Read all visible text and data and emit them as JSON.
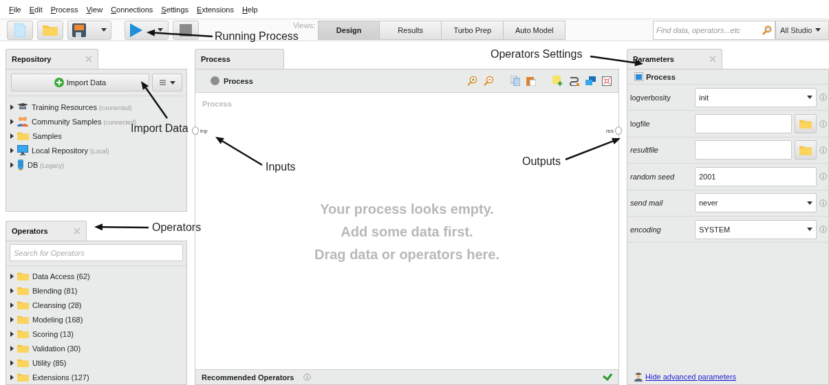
{
  "menu": [
    "File",
    "Edit",
    "Process",
    "View",
    "Connections",
    "Settings",
    "Extensions",
    "Help"
  ],
  "toolbar": {
    "views_label": "Views:",
    "views": [
      {
        "label": "Design",
        "selected": true
      },
      {
        "label": "Results",
        "selected": false
      },
      {
        "label": "Turbo Prep",
        "selected": false
      },
      {
        "label": "Auto Model",
        "selected": false
      }
    ],
    "search": {
      "placeholder": "Find data, operators...etc"
    },
    "scope": "All Studio"
  },
  "repository": {
    "title": "Repository",
    "import_button": "Import Data",
    "items": [
      {
        "kind": "training",
        "name": "Training Resources",
        "note": "(connected)",
        "expanded": false
      },
      {
        "kind": "community",
        "name": "Community Samples",
        "note": "(connected)",
        "expanded": false
      },
      {
        "kind": "folder",
        "name": "Samples",
        "expanded": false
      },
      {
        "kind": "local",
        "name": "Local Repository",
        "note": "(Local)",
        "expanded": false
      },
      {
        "kind": "database",
        "name": "DB",
        "note": "(Legacy)",
        "expanded": false
      }
    ]
  },
  "operators": {
    "title": "Operators",
    "search": {
      "placeholder": "Search for Operators"
    },
    "items": [
      {
        "name": "Data Access (62)",
        "expanded": false
      },
      {
        "name": "Blending (81)",
        "expanded": false
      },
      {
        "name": "Cleansing (28)",
        "expanded": false
      },
      {
        "name": "Modeling (168)",
        "expanded": false
      },
      {
        "name": "Scoring (13)",
        "expanded": false
      },
      {
        "name": "Validation (30)",
        "expanded": false
      },
      {
        "name": "Utility (85)",
        "expanded": false
      },
      {
        "name": "Extensions (127)",
        "expanded": false
      }
    ]
  },
  "process": {
    "title": "Process",
    "breadcrumb": "Process",
    "canvas_label": "Process",
    "input_port": "inp",
    "output_port": "res",
    "empty_message": [
      "Your process looks empty.",
      "Add some data first.",
      "Drag data or operators here."
    ],
    "recommended": "Recommended Operators"
  },
  "parameters": {
    "title": "Parameters",
    "operator": "Process",
    "rows": [
      {
        "kind": "select",
        "label": "logverbosity",
        "expert": false,
        "value": "init"
      },
      {
        "kind": "file",
        "label": "logfile",
        "expert": false
      },
      {
        "kind": "file",
        "label": "resultfile",
        "expert": true
      },
      {
        "kind": "text",
        "label": "random seed",
        "expert": true,
        "value": "2001"
      },
      {
        "kind": "select",
        "label": "send mail",
        "expert": true,
        "value": "never"
      },
      {
        "kind": "select",
        "label": "encoding",
        "expert": true,
        "value": "SYSTEM"
      }
    ],
    "advanced_link": "Hide advanced parameters"
  },
  "annotations": [
    "Running Process",
    "Import Data",
    "Inputs",
    "Outputs",
    "Operators Settings",
    "Operators"
  ]
}
